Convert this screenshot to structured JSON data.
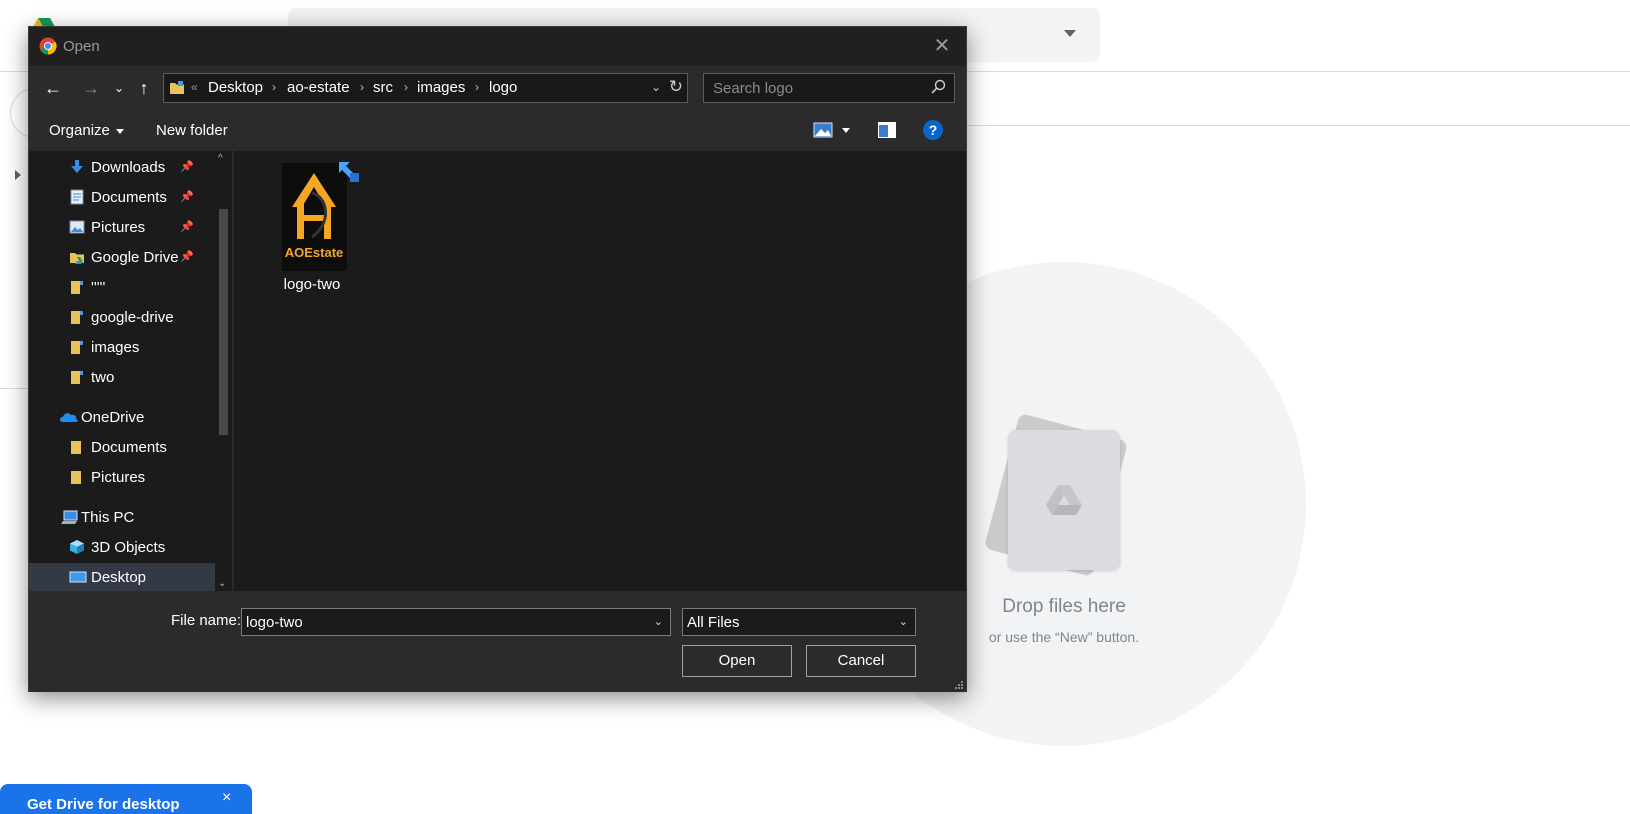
{
  "background": {
    "drop_title": "Drop files here",
    "drop_subtitle": "or use the “New” button.",
    "promo_text": "Get Drive for desktop",
    "promo_close": "×",
    "search_dropdown_icon": "caret-down-icon"
  },
  "dialog": {
    "title": "Open",
    "close_glyph": "✕",
    "nav": {
      "back_glyph": "←",
      "forward_glyph": "→",
      "recent_glyph": "⌄",
      "up_glyph": "↑"
    },
    "address": {
      "overflow_glyph": "«",
      "crumbs": [
        "Desktop",
        "ao-estate",
        "src",
        "images",
        "logo"
      ],
      "separator": "›",
      "dropdown_glyph": "⌄",
      "refresh_glyph": "↻"
    },
    "search": {
      "placeholder": "Search logo"
    },
    "toolbar": {
      "organize_label": "Organize",
      "new_folder_label": "New folder",
      "help_label": "?"
    },
    "sidebar": {
      "items": [
        {
          "label": "Downloads",
          "icon": "downloads-icon",
          "pinned": true
        },
        {
          "label": "Documents",
          "icon": "documents-icon",
          "pinned": true
        },
        {
          "label": "Pictures",
          "icon": "pictures-icon",
          "pinned": true
        },
        {
          "label": "Google Drive",
          "icon": "google-drive-icon",
          "pinned": true
        },
        {
          "label": "'''''",
          "icon": "folder-icon",
          "pinned": false
        },
        {
          "label": "google-drive",
          "icon": "folder-icon",
          "pinned": false
        },
        {
          "label": "images",
          "icon": "folder-icon",
          "pinned": false
        },
        {
          "label": "two",
          "icon": "folder-icon",
          "pinned": false
        },
        {
          "label": "OneDrive",
          "icon": "onedrive-icon",
          "pinned": false
        },
        {
          "label": "Documents",
          "icon": "folder-icon",
          "pinned": false
        },
        {
          "label": "Pictures",
          "icon": "folder-icon",
          "pinned": false
        },
        {
          "label": "This PC",
          "icon": "computer-icon",
          "pinned": false
        },
        {
          "label": "3D Objects",
          "icon": "3d-objects-icon",
          "pinned": false
        },
        {
          "label": "Desktop",
          "icon": "desktop-icon",
          "pinned": false,
          "selected": true
        }
      ],
      "pin_glyph": "📌"
    },
    "files": [
      {
        "name": "logo-two",
        "thumb_text": "AOEstate"
      }
    ],
    "footer": {
      "file_name_label": "File name:",
      "file_name_value": "logo-two",
      "file_type_value": "All Files",
      "open_label": "Open",
      "cancel_label": "Cancel",
      "dropdown_glyph": "⌄"
    },
    "colors": {
      "accent_blue": "#0a66c8",
      "thumb_gold": "#f5a623",
      "folder_yellow": "#e8c35a"
    }
  }
}
